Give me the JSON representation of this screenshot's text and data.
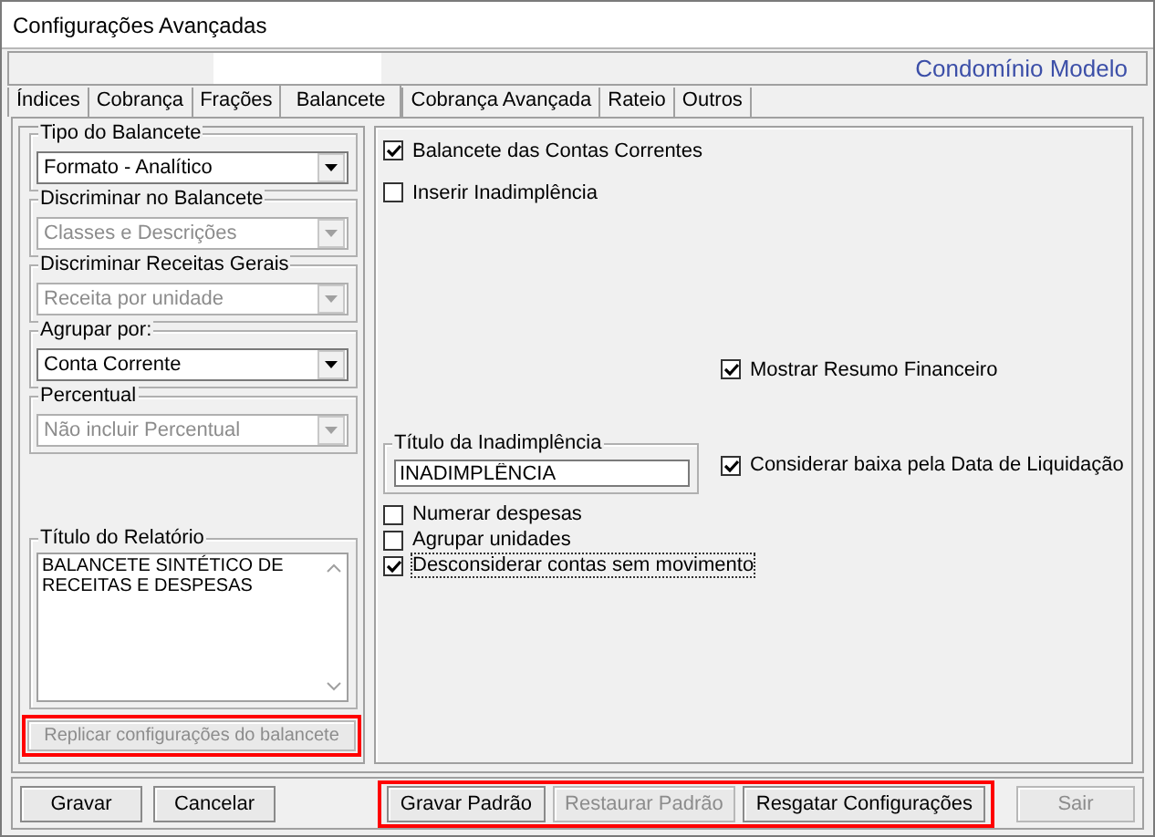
{
  "window": {
    "title": "Configurações Avançadas"
  },
  "header": {
    "condominium": "Condomínio Modelo"
  },
  "tabs": [
    {
      "label": "Índices",
      "selected": false
    },
    {
      "label": "Cobrança",
      "selected": false
    },
    {
      "label": "Frações",
      "selected": false
    },
    {
      "label": "Balancete",
      "selected": true
    },
    {
      "label": "Cobrança Avançada",
      "selected": false
    },
    {
      "label": "Rateio",
      "selected": false
    },
    {
      "label": "Outros",
      "selected": false
    }
  ],
  "left_groups": [
    {
      "label": "Tipo do Balancete",
      "value": "Formato - Analítico",
      "disabled": false
    },
    {
      "label": "Discriminar no Balancete",
      "value": "Classes e Descrições",
      "disabled": true
    },
    {
      "label": "Discriminar Receitas Gerais",
      "value": "Receita por unidade",
      "disabled": true
    },
    {
      "label": "Agrupar por:",
      "value": "Conta Corrente",
      "disabled": false
    },
    {
      "label": "Percentual",
      "value": "Não incluir Percentual",
      "disabled": true
    }
  ],
  "report_title": {
    "label": "Título do Relatório",
    "value": "BALANCETE SINTÉTICO DE RECEITAS E DESPESAS"
  },
  "replicate_button": {
    "label": "Replicar configurações do balancete",
    "disabled": true,
    "highlighted": true
  },
  "options_top": [
    {
      "label": "Balancete das Contas Correntes",
      "checked": true
    },
    {
      "label": "Inserir Inadimplência",
      "checked": false
    }
  ],
  "summary_option": {
    "label": "Mostrar Resumo Financeiro",
    "checked": true
  },
  "delinquency_title": {
    "label": "Título da Inadimplência",
    "value": "INADIMPLÊNCIA"
  },
  "settle_option": {
    "label": "Considerar baixa pela Data de Liquidação",
    "checked": true
  },
  "options_bottom": [
    {
      "label": "Numerar despesas",
      "checked": false,
      "focused": false
    },
    {
      "label": "Agrupar unidades",
      "checked": false,
      "focused": false
    },
    {
      "label": "Desconsiderar contas sem movimento",
      "checked": true,
      "focused": true
    }
  ],
  "footer": {
    "left_buttons": [
      {
        "label": "Gravar",
        "disabled": false
      },
      {
        "label": "Cancelar",
        "disabled": false
      }
    ],
    "highlight_group": {
      "highlighted": true,
      "buttons": [
        {
          "label": "Gravar Padrão",
          "disabled": false
        },
        {
          "label": "Restaurar Padrão",
          "disabled": true
        },
        {
          "label": "Resgatar Configurações",
          "disabled": false
        }
      ]
    },
    "exit_button": {
      "label": "Sair",
      "disabled": true
    }
  }
}
